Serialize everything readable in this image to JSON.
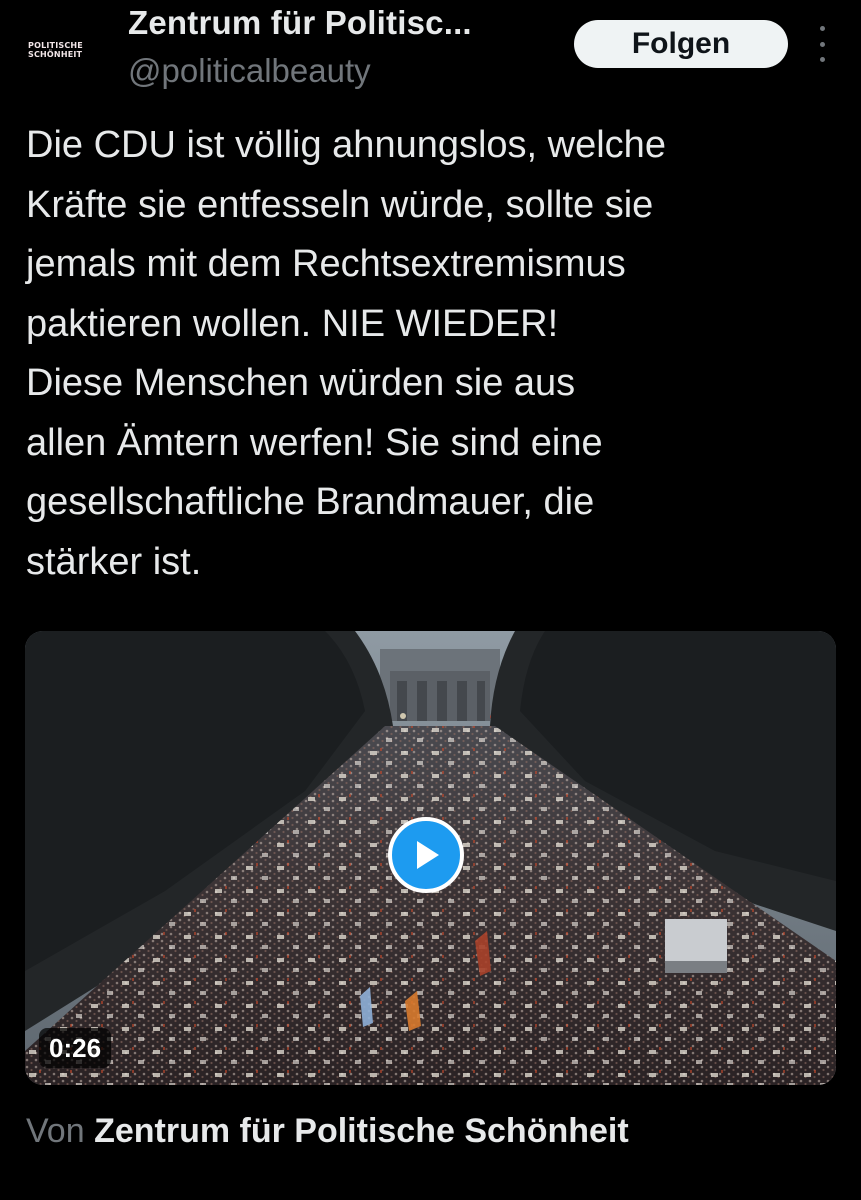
{
  "header": {
    "avatar_logo_lines": [
      "POLITISCHE",
      "SCHÖNHEIT"
    ],
    "account_name": "Zentrum für Politisc...",
    "handle": "@politicalbeauty",
    "follow_label": "Folgen",
    "more_icon": "more-vertical-icon"
  },
  "tweet": {
    "text": "Die CDU ist völlig ahnungslos, welche\nKräfte sie entfesseln würde, sollte sie\njemals mit dem Rechtsextremismus\npaktieren wollen. NIE WIEDER!\nDiese Menschen würden sie aus\nallen Ämtern werfen! Sie sind eine\ngesellschaftliche Brandmauer, die\nstärker ist."
  },
  "video": {
    "duration": "0:26",
    "play_icon": "play-icon",
    "accent_color": "#1d9bf0"
  },
  "source": {
    "prefix": "Von",
    "name": "Zentrum für Politische Schönheit"
  },
  "colors": {
    "background": "#000000",
    "text": "#e7e9ea",
    "secondary": "#71767b",
    "follow_bg": "#eff3f4"
  }
}
